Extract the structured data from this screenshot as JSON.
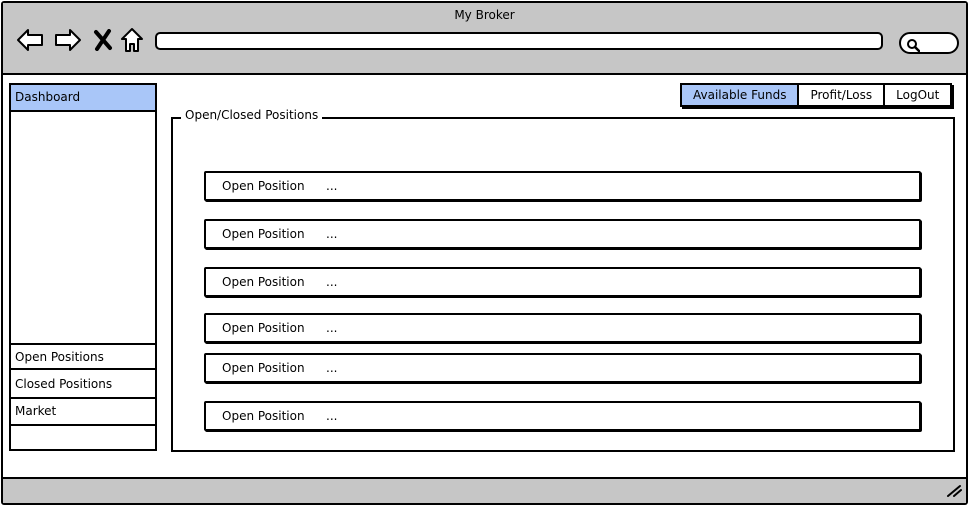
{
  "window": {
    "title": "My Broker"
  },
  "browser": {
    "address_value": "",
    "icons": [
      "back-arrow-icon",
      "forward-arrow-icon",
      "close-x-icon",
      "home-icon",
      "search-icon",
      "resize-grip-icon"
    ]
  },
  "sidebar": {
    "items": [
      {
        "label": "Dashboard",
        "active": true
      },
      {
        "label": "Open Positions",
        "active": false
      },
      {
        "label": "Closed Positions",
        "active": false
      },
      {
        "label": "Market",
        "active": false
      },
      {
        "label": "",
        "active": false
      }
    ]
  },
  "topnav": {
    "tabs": [
      {
        "label": "Available Funds",
        "active": true
      },
      {
        "label": "Profit/Loss",
        "active": false
      },
      {
        "label": "LogOut",
        "active": false
      }
    ]
  },
  "positions_panel": {
    "legend": "Open/Closed Positions",
    "rows": [
      {
        "label": "Open Position",
        "detail": "..."
      },
      {
        "label": "Open Position",
        "detail": "..."
      },
      {
        "label": "Open Position",
        "detail": "..."
      },
      {
        "label": "Open Position",
        "detail": "..."
      },
      {
        "label": "Open Position",
        "detail": "..."
      },
      {
        "label": "Open Position",
        "detail": "..."
      }
    ]
  },
  "colors": {
    "chrome": "#c6c6c6",
    "accent": "#a9c6f8",
    "line": "#000000"
  }
}
